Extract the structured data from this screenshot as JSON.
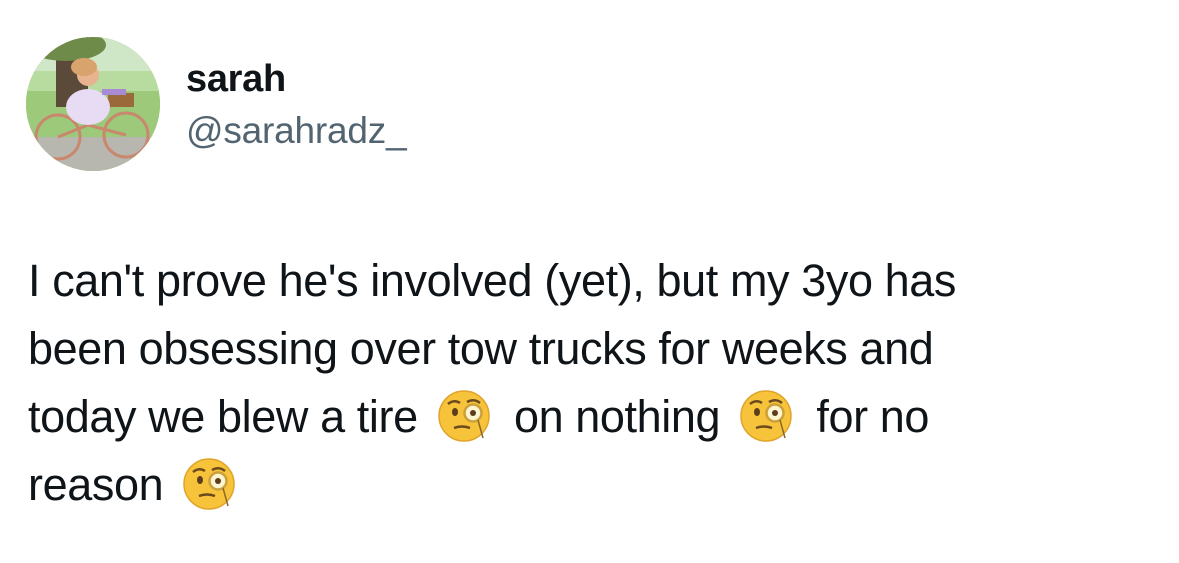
{
  "user": {
    "display_name": "sarah",
    "handle": "@sarahradz_",
    "avatar_icon": "profile-photo-girl-on-bicycle"
  },
  "tweet": {
    "lines": [
      {
        "text": "I can't prove he's involved (yet), but my 3yo has"
      },
      {
        "text": "been obsessing over tow trucks for weeks and"
      },
      {
        "parts": [
          "today we blew a tire",
          "on nothing",
          "for no"
        ]
      },
      {
        "parts": [
          "reason"
        ]
      }
    ],
    "emoji": "face-with-monocle",
    "emoji_char": "🧐"
  },
  "colors": {
    "text": "#0f1419",
    "secondary": "#536471",
    "background": "#ffffff",
    "emoji_face": "#f6c33a"
  }
}
